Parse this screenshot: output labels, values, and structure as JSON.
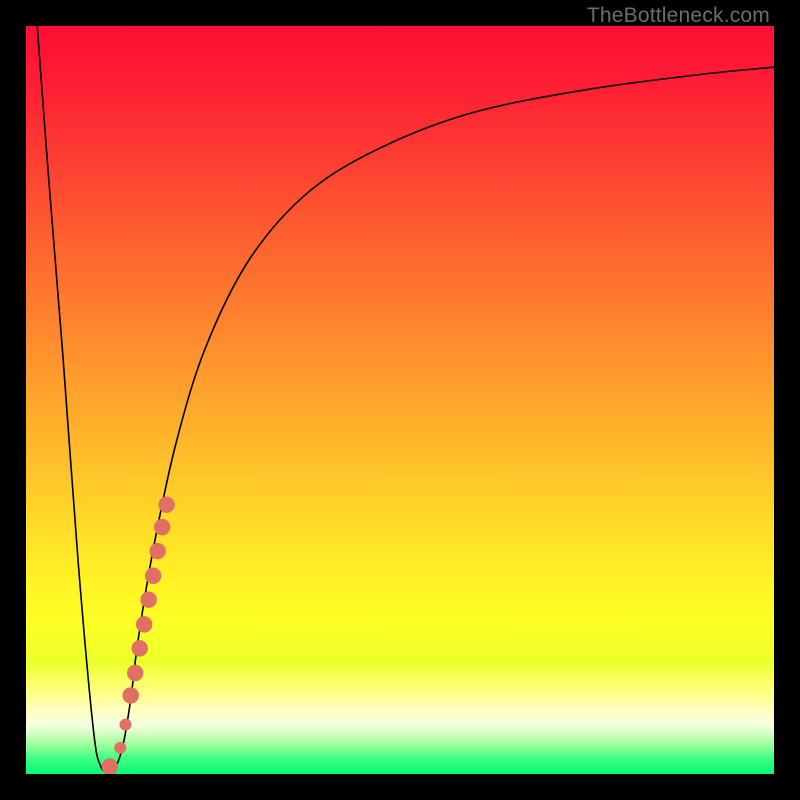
{
  "watermark": "TheBottleneck.com",
  "colors": {
    "frame": "#000000",
    "curve": "#000000",
    "marker": "#e17064",
    "gradient_stops": [
      {
        "offset": 0.0,
        "color": "#fd0e34"
      },
      {
        "offset": 0.08,
        "color": "#fd1f34"
      },
      {
        "offset": 0.18,
        "color": "#fd3e32"
      },
      {
        "offset": 0.3,
        "color": "#fe6530"
      },
      {
        "offset": 0.42,
        "color": "#fe8c2e"
      },
      {
        "offset": 0.54,
        "color": "#feb22b"
      },
      {
        "offset": 0.66,
        "color": "#fed928"
      },
      {
        "offset": 0.74,
        "color": "#fef226"
      },
      {
        "offset": 0.8,
        "color": "#fcff26"
      },
      {
        "offset": 0.85,
        "color": "#ecff2a"
      },
      {
        "offset": 0.89,
        "color": "#ffff82"
      },
      {
        "offset": 0.915,
        "color": "#ffffc2"
      },
      {
        "offset": 0.935,
        "color": "#f2ffe0"
      },
      {
        "offset": 0.95,
        "color": "#c5ffb7"
      },
      {
        "offset": 0.965,
        "color": "#8aff94"
      },
      {
        "offset": 0.98,
        "color": "#39fe82"
      },
      {
        "offset": 1.0,
        "color": "#06fc76"
      }
    ]
  },
  "chart_data": {
    "type": "line",
    "title": "",
    "xlabel": "",
    "ylabel": "",
    "xlim": [
      0,
      100
    ],
    "ylim": [
      0,
      100
    ],
    "series": [
      {
        "name": "bottleneck-curve",
        "x": [
          1.5,
          3,
          5,
          7,
          9,
          10,
          11,
          12,
          13,
          14,
          15,
          17,
          20,
          24,
          30,
          38,
          48,
          60,
          75,
          90,
          100
        ],
        "y": [
          100,
          80,
          55,
          28,
          6,
          1,
          0.5,
          1,
          4,
          10,
          18,
          30,
          44,
          57,
          69,
          78,
          84,
          88.5,
          91.5,
          93.5,
          94.5
        ]
      }
    ],
    "markers": {
      "name": "highlighted-segment",
      "points": [
        {
          "x": 11.2,
          "y": 1.0,
          "r": 1.1
        },
        {
          "x": 12.6,
          "y": 3.5,
          "r": 0.8
        },
        {
          "x": 13.3,
          "y": 6.6,
          "r": 0.8
        },
        {
          "x": 14.0,
          "y": 10.5,
          "r": 1.1
        },
        {
          "x": 14.6,
          "y": 13.5,
          "r": 1.1
        },
        {
          "x": 15.2,
          "y": 16.8,
          "r": 1.1
        },
        {
          "x": 15.8,
          "y": 20.0,
          "r": 1.1
        },
        {
          "x": 16.4,
          "y": 23.3,
          "r": 1.1
        },
        {
          "x": 17.0,
          "y": 26.5,
          "r": 1.1
        },
        {
          "x": 17.6,
          "y": 29.8,
          "r": 1.1
        },
        {
          "x": 18.2,
          "y": 33.0,
          "r": 1.1
        },
        {
          "x": 18.8,
          "y": 36.0,
          "r": 1.1
        }
      ]
    }
  }
}
